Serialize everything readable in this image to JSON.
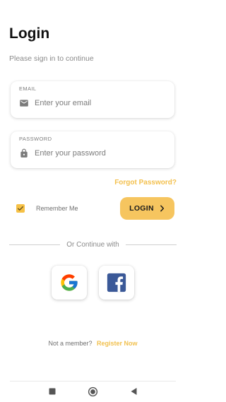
{
  "header": {
    "title": "Login",
    "subtitle": "Please sign in to continue"
  },
  "email": {
    "label": "EMAIL",
    "placeholder": "Enter your email",
    "value": "",
    "icon": "mail-icon"
  },
  "password": {
    "label": "PASSWORD",
    "placeholder": "Enter your password",
    "value": "",
    "icon": "lock-icon"
  },
  "forgot_password": "Forgot Password?",
  "remember_me": {
    "label": "Remember Me",
    "checked": true
  },
  "login_button": {
    "label": "LOGIN",
    "icon": "chevron-right-icon"
  },
  "divider_text": "Or Continue with",
  "social": [
    {
      "name": "Google",
      "icon": "google-icon"
    },
    {
      "name": "Facebook",
      "icon": "facebook-icon"
    }
  ],
  "footer": {
    "prompt": "Not a member?",
    "register_link": "Register Now"
  },
  "colors": {
    "accent": "#f6c55f",
    "link": "#f1c04e",
    "facebook": "#3b5998"
  },
  "system_nav": [
    "recent-apps-icon",
    "home-icon",
    "back-icon"
  ]
}
